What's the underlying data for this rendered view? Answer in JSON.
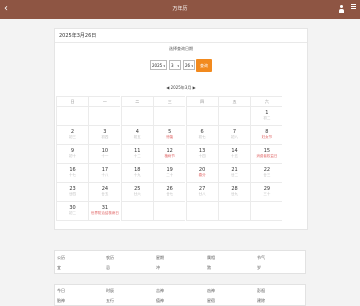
{
  "topbar": {
    "title": "万年历",
    "back_glyph": "‹"
  },
  "card": {
    "date_heading": "2025年3月26日",
    "sub_label": "选择查询日期"
  },
  "controls": {
    "year": "2025",
    "month": "3",
    "day": "26",
    "go_label": "查询"
  },
  "calendar": {
    "caption": "◀ 2025年3月 ▶",
    "weekdays": [
      "日",
      "一",
      "二",
      "三",
      "四",
      "五",
      "六"
    ],
    "rows": [
      [
        {
          "d": "",
          "s": ""
        },
        {
          "d": "",
          "s": ""
        },
        {
          "d": "",
          "s": ""
        },
        {
          "d": "",
          "s": ""
        },
        {
          "d": "",
          "s": ""
        },
        {
          "d": "",
          "s": ""
        },
        {
          "d": "1",
          "s": "初二"
        }
      ],
      [
        {
          "d": "2",
          "s": "初三"
        },
        {
          "d": "3",
          "s": "初四"
        },
        {
          "d": "4",
          "s": "初五"
        },
        {
          "d": "5",
          "s": "惊蛰"
        },
        {
          "d": "6",
          "s": "初七"
        },
        {
          "d": "7",
          "s": "初八"
        },
        {
          "d": "8",
          "s": "妇女节"
        }
      ],
      [
        {
          "d": "9",
          "s": "初十"
        },
        {
          "d": "10",
          "s": "十一"
        },
        {
          "d": "11",
          "s": "十二"
        },
        {
          "d": "12",
          "s": "植树节"
        },
        {
          "d": "13",
          "s": "十四"
        },
        {
          "d": "14",
          "s": "十五"
        },
        {
          "d": "15",
          "s": "消费者权益日"
        }
      ],
      [
        {
          "d": "16",
          "s": "十七"
        },
        {
          "d": "17",
          "s": "十八"
        },
        {
          "d": "18",
          "s": "十九"
        },
        {
          "d": "19",
          "s": "二十"
        },
        {
          "d": "20",
          "s": "春分"
        },
        {
          "d": "21",
          "s": "廿二"
        },
        {
          "d": "22",
          "s": "廿三"
        }
      ],
      [
        {
          "d": "23",
          "s": "廿四"
        },
        {
          "d": "24",
          "s": "廿五"
        },
        {
          "d": "25",
          "s": "廿六"
        },
        {
          "d": "26",
          "s": "廿七"
        },
        {
          "d": "27",
          "s": "廿八"
        },
        {
          "d": "28",
          "s": "廿九"
        },
        {
          "d": "29",
          "s": "三十"
        }
      ],
      [
        {
          "d": "30",
          "s": "初二"
        },
        {
          "d": "31",
          "s": "世界防治结核病日"
        },
        {
          "d": "",
          "s": ""
        },
        {
          "d": "",
          "s": ""
        },
        {
          "d": "",
          "s": ""
        },
        {
          "d": "",
          "s": ""
        },
        {
          "d": "",
          "s": ""
        }
      ]
    ]
  },
  "info_panel_1": {
    "row1": [
      "公历",
      "农历",
      "星期",
      "属相",
      "节气"
    ],
    "row2": [
      "宜",
      "忌",
      "冲",
      "煞",
      "岁"
    ]
  },
  "info_panel_2": {
    "row1": [
      "今日",
      "时辰",
      "吉神",
      "凶神",
      "彭祖"
    ],
    "row2": [
      "胎神",
      "五行",
      "值神",
      "星宿",
      "建除"
    ]
  }
}
